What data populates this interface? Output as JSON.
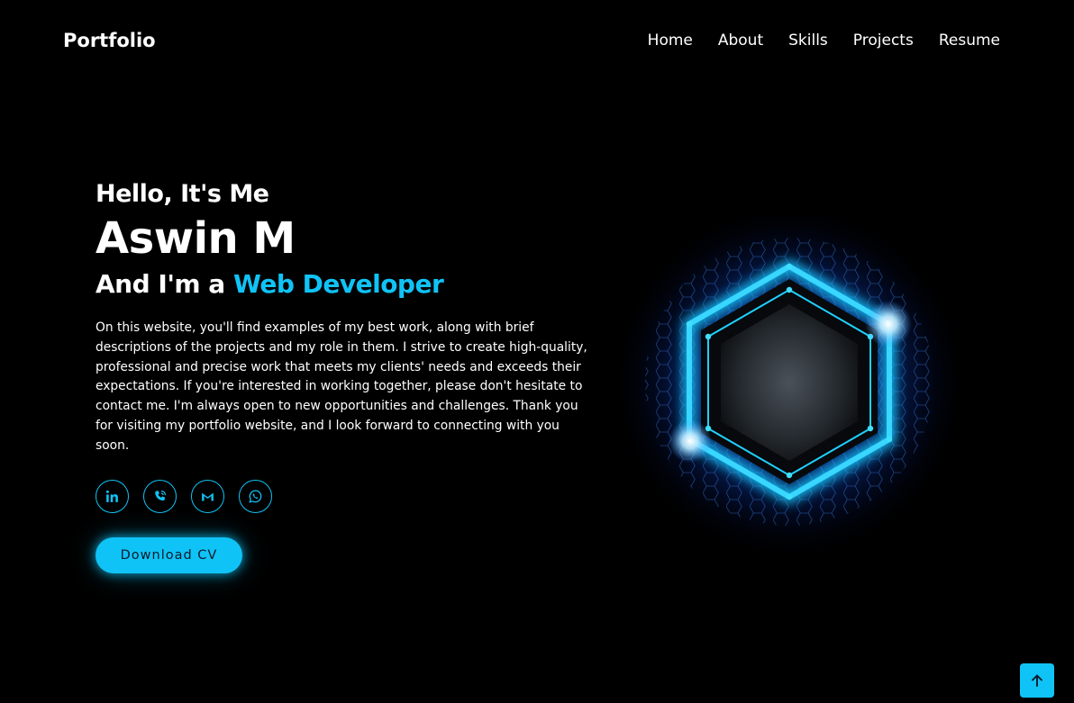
{
  "header": {
    "logo": "Portfolio",
    "nav": [
      {
        "label": "Home"
      },
      {
        "label": "About"
      },
      {
        "label": "Skills"
      },
      {
        "label": "Projects"
      },
      {
        "label": "Resume"
      }
    ]
  },
  "hero": {
    "greeting": "Hello, It's Me",
    "name": "Aswin M",
    "role_prefix": "And I'm a ",
    "role_highlight": "Web Developer",
    "description": "On this website, you'll find examples of my best work, along with brief descriptions of the projects and my role in them. I strive to create high-quality, professional and precise work that meets my clients' needs and exceeds their expectations. If you're interested in working together, please don't hesitate to contact me. I'm always open to new opportunities and challenges. Thank you for visiting my portfolio website, and I look forward to connecting with you soon.",
    "socials": [
      {
        "icon": "linkedin-icon"
      },
      {
        "icon": "phone-icon"
      },
      {
        "icon": "gmail-icon"
      },
      {
        "icon": "whatsapp-icon"
      }
    ],
    "download_label": "Download CV"
  },
  "hero_image": {
    "icon": "glowing-hexagon"
  },
  "scroll_top": {
    "icon": "arrow-up-icon"
  },
  "colors": {
    "background": "#000000",
    "accent": "#10c3f6",
    "text": "#ffffff"
  }
}
